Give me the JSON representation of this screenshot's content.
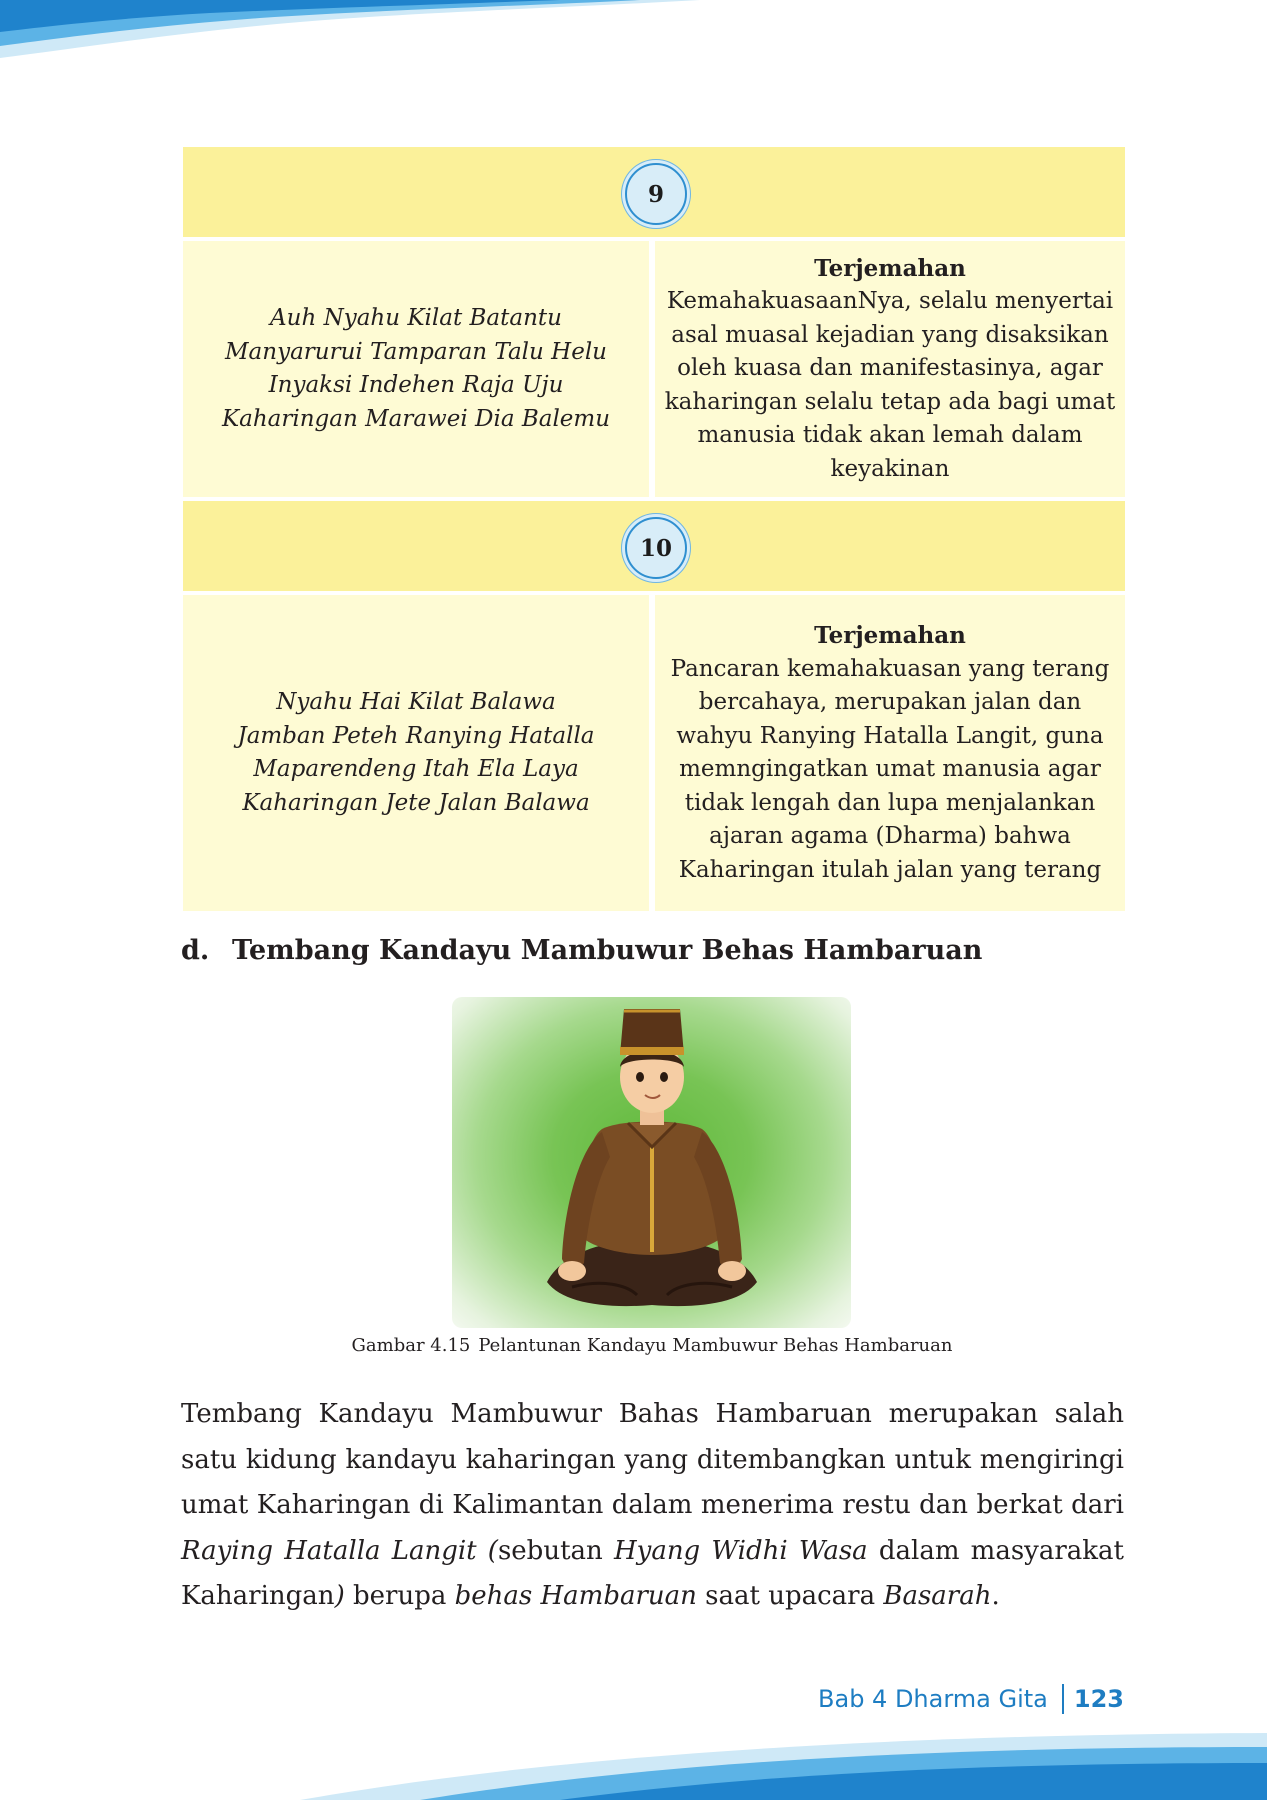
{
  "verses": [
    {
      "number": "9",
      "lines": [
        "Auh Nyahu Kilat Batantu",
        "Manyarurui Tamparan Talu Helu",
        "Inyaksi Indehen Raja Uju",
        "Kaharingan Marawei Dia Balemu"
      ],
      "translation_title": "Terjemahan",
      "translation_lines": [
        "KemahakuasaanNya, selalu menyertai",
        "asal muasal kejadian yang disaksikan",
        "oleh kuasa dan manifestasinya, agar",
        "kaharingan selalu tetap ada bagi umat",
        "manusia tidak akan lemah dalam",
        "keyakinan"
      ]
    },
    {
      "number": "10",
      "lines": [
        "Nyahu Hai Kilat Balawa",
        "Jamban Peteh Ranying Hatalla",
        "Maparendeng Itah Ela Laya",
        "Kaharingan Jete Jalan Balawa"
      ],
      "translation_title": "Terjemahan",
      "translation_lines": [
        "Pancaran kemahakuasan yang terang",
        "bercahaya, merupakan jalan dan",
        "wahyu Ranying Hatalla Langit, guna",
        "memngingatkan umat manusia agar",
        "tidak lengah dan lupa menjalankan",
        "ajaran agama (Dharma) bahwa",
        "Kaharingan itulah jalan yang terang"
      ]
    }
  ],
  "section": {
    "letter": "d.",
    "title": "Tembang Kandayu Mambuwur Behas Hambaruan"
  },
  "figure": {
    "caption_label": "Gambar 4.15",
    "caption_text": "Pelantunan Kandayu Mambuwur Behas Hambaruan"
  },
  "paragraph": {
    "p1": "Tembang Kandayu Mambuwur Bahas Hambaruan merupakan salah satu kidung kandayu kaharingan yang ditembangkan untuk mengiringi umat Kaharingan di Kalimantan dalam menerima restu dan berkat dari ",
    "i1": "Raying Hatalla Langit (",
    "p2": "sebutan ",
    "i2": "Hyang Widhi Wasa",
    "p3": " dalam masyarakat Kaharingan",
    "i3": ")",
    "p4": " berupa ",
    "i4": "behas Hambaruan",
    "p5": " saat upacara ",
    "i5": "Basarah",
    "p6": "."
  },
  "footer": {
    "chapter": "Bab 4 Dharma Gita",
    "page_number": "123"
  },
  "colors": {
    "band": "#fbf19a",
    "cell": "#fefbd4",
    "accent_blue": "#1e7dc2"
  }
}
